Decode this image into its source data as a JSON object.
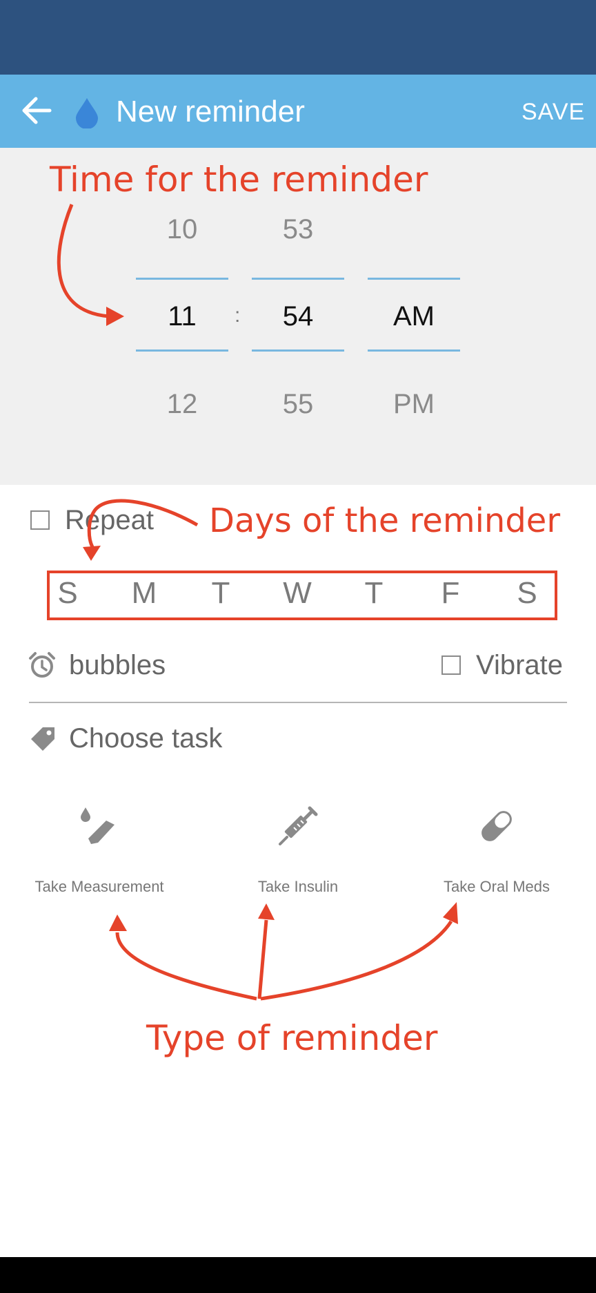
{
  "header": {
    "title": "New reminder",
    "save_label": "SAVE"
  },
  "time_picker": {
    "hour": {
      "prev": "10",
      "selected": "11",
      "next": "12"
    },
    "minute": {
      "prev": "53",
      "selected": "54",
      "next": "55"
    },
    "period": {
      "selected": "AM",
      "next": "PM"
    },
    "separator": ":"
  },
  "repeat": {
    "label": "Repeat",
    "checked": false
  },
  "days": [
    "S",
    "M",
    "T",
    "W",
    "T",
    "F",
    "S"
  ],
  "alarm": {
    "sound": "bubbles",
    "vibrate_label": "Vibrate",
    "vibrate_checked": false
  },
  "task": {
    "choose_label": "Choose task",
    "options": [
      {
        "label": "Take Measurement",
        "icon": "measurement-icon"
      },
      {
        "label": "Take Insulin",
        "icon": "syringe-icon"
      },
      {
        "label": "Take Oral Meds",
        "icon": "pill-icon"
      }
    ]
  },
  "annotations": {
    "time": "Time for the reminder",
    "days": "Days of the reminder",
    "type": "Type of reminder"
  },
  "colors": {
    "status_bar": "#2d527f",
    "app_bar": "#63b4e4",
    "annotation": "#e5432a",
    "picker_line": "#79b8e0"
  }
}
